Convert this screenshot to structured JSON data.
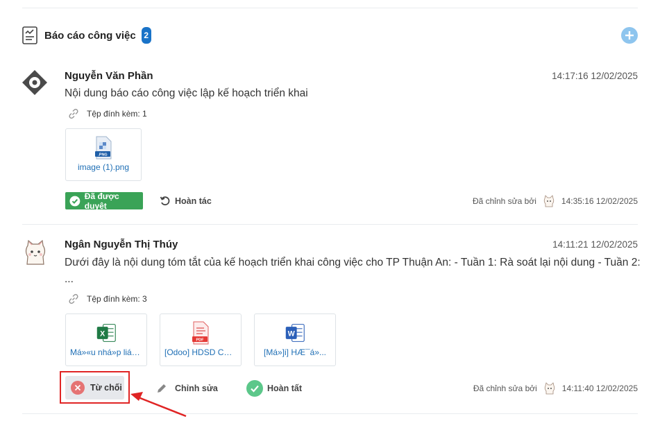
{
  "section": {
    "title": "Báo cáo công việc",
    "count": "2"
  },
  "colors": {
    "accent": "#1a73c8",
    "approved": "#3aa357",
    "reject": "#e57373",
    "done": "#5cc78a",
    "highlight": "#e02424",
    "link": "#1f6fb5"
  },
  "reports": [
    {
      "author": "Nguyễn Văn Phần",
      "time": "14:17:16 12/02/2025",
      "content": "Nội dung báo cáo công việc lập kế hoạch triển khai",
      "attachments_label": "Tệp đính kèm: 1",
      "files": [
        {
          "name": "image (1).png",
          "type": "png",
          "ext": ".PNG"
        }
      ],
      "status": "Đã được duyệt",
      "undo_label": "Hoàn tác",
      "edited_label": "Đã chỉnh sửa bởi",
      "edited_time": "14:35:16 12/02/2025"
    },
    {
      "author": "Ngân Nguyễn Thị Thúy",
      "time": "14:11:21 12/02/2025",
      "content": "Dưới đây là nội dung tóm tắt của kế hoạch triển khai công việc cho TP Thuận An: - Tuần 1: Rà soát lại nội dung - Tuần 2: ...",
      "attachments_label": "Tệp đính kèm: 3",
      "files": [
        {
          "name": "Má»«u nhá»p liá»...",
          "type": "excel",
          "ext": "X"
        },
        {
          "name": "[Odoo] HDSD CH...",
          "type": "pdf",
          "ext": "PDF"
        },
        {
          "name": "[Má»]i] HÆ¯á»...",
          "type": "word",
          "ext": "W"
        }
      ],
      "reject_label": "Từ chối",
      "edit_label": "Chỉnh sửa",
      "complete_label": "Hoàn tất",
      "edited_label": "Đã chỉnh sửa bởi",
      "edited_time": "14:11:40 12/02/2025"
    }
  ]
}
